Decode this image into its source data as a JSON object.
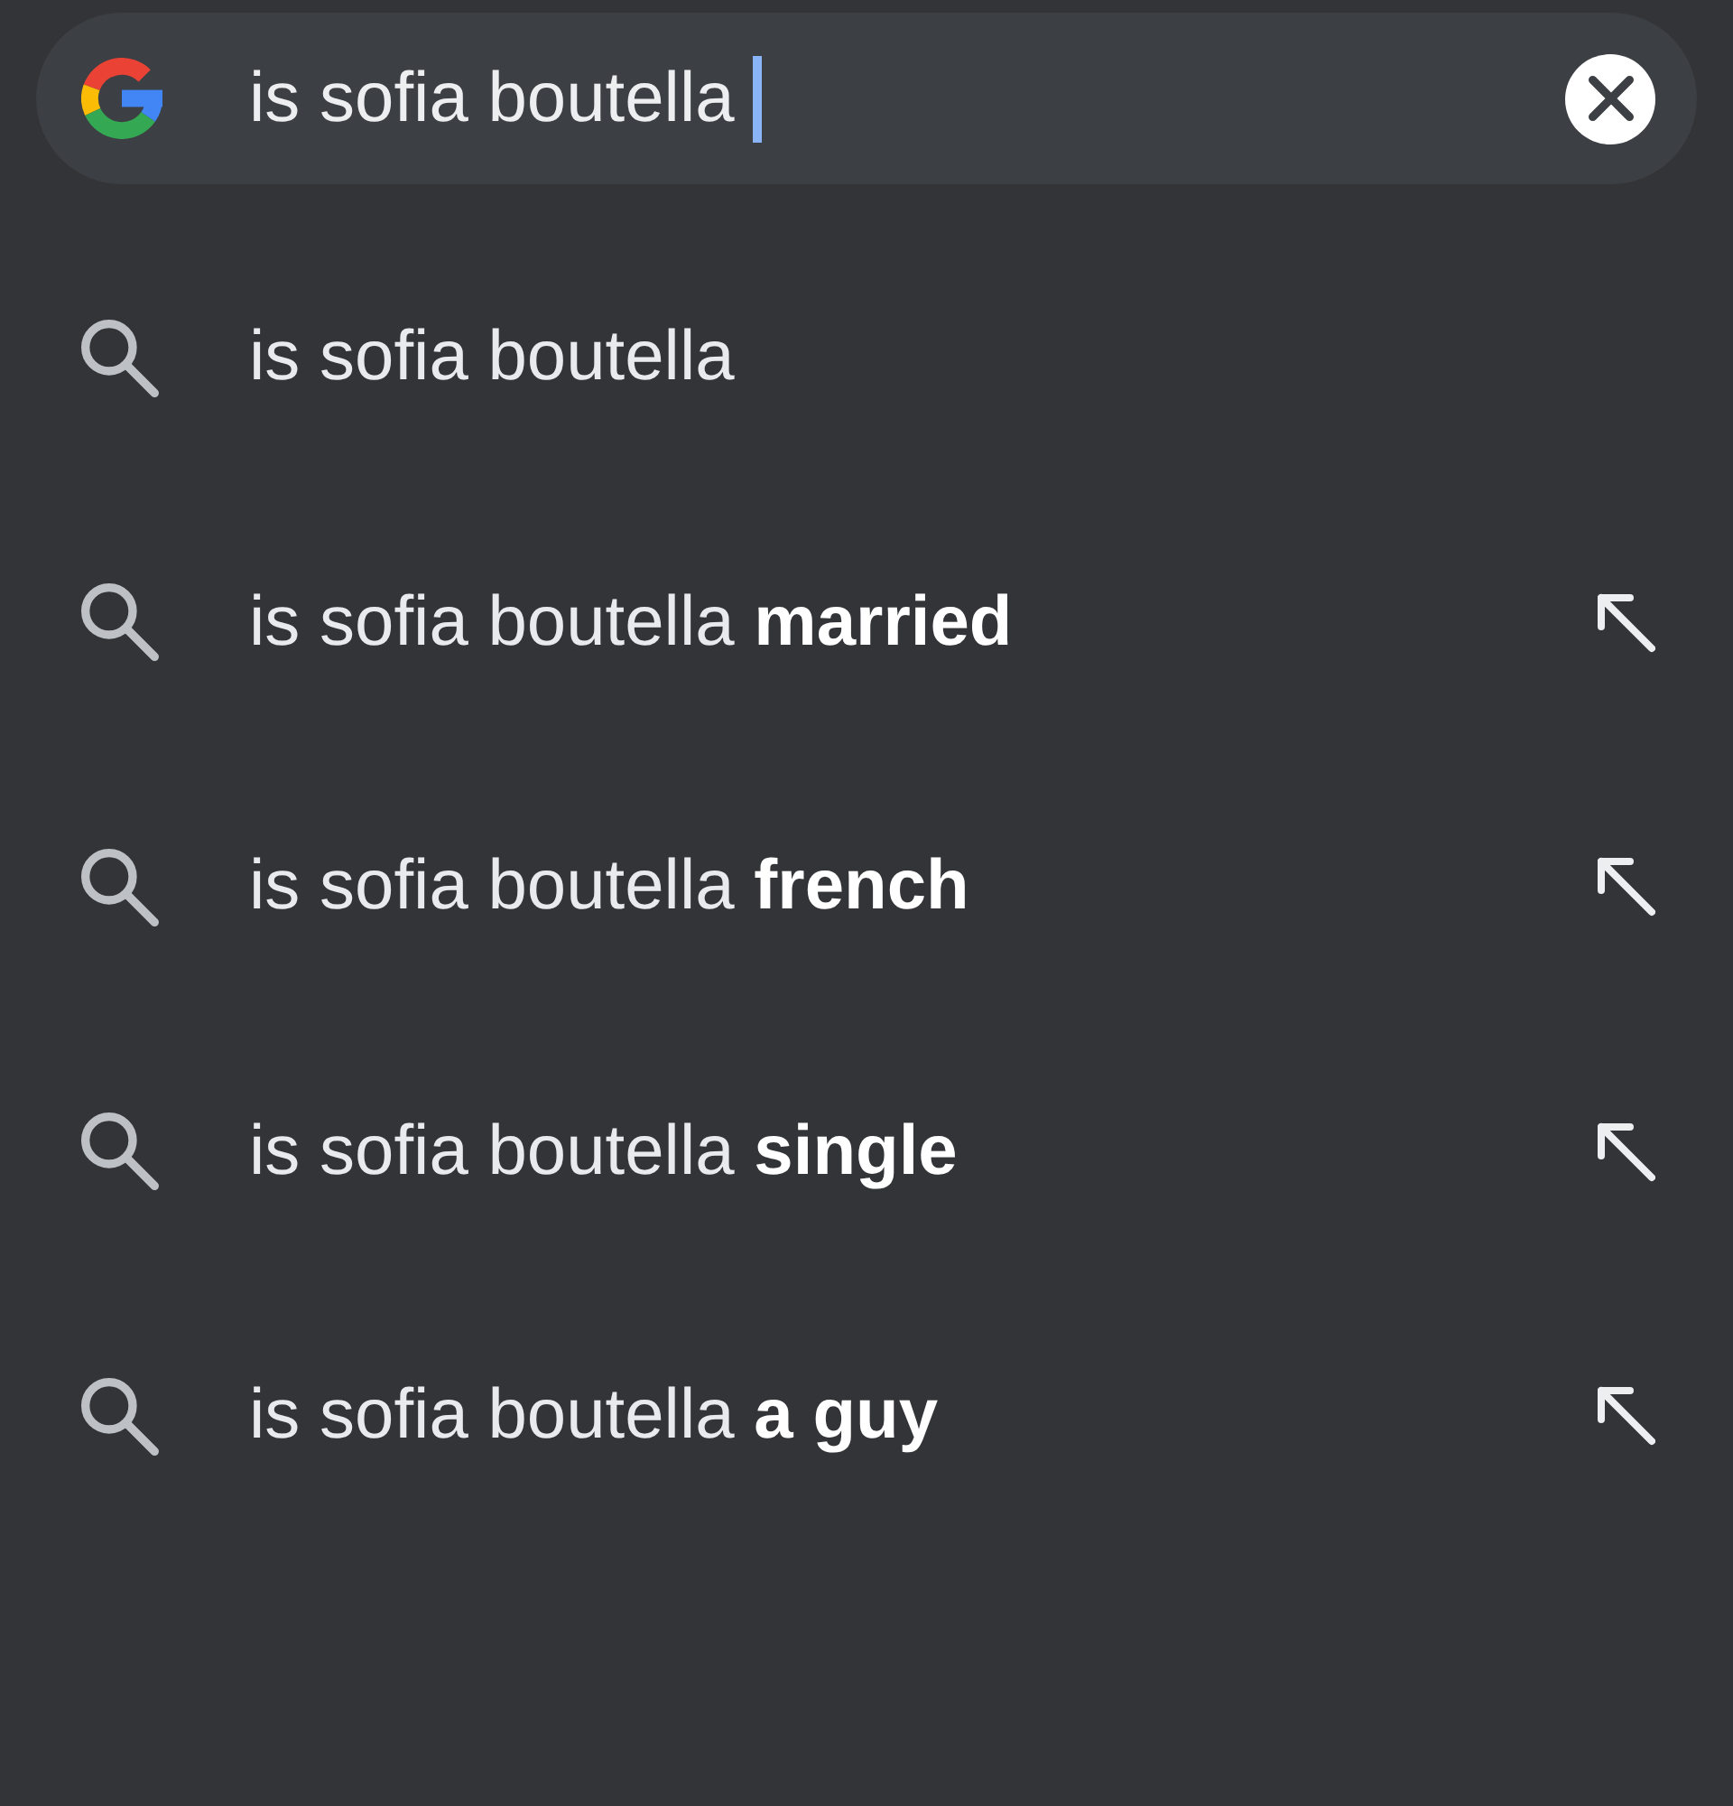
{
  "search_bar": {
    "value": "is sofia boutella"
  },
  "suggestions": [
    {
      "kind": "query",
      "text": "is sofia boutella"
    },
    {
      "kind": "completion",
      "text": "is sofia boutella **married**"
    },
    {
      "kind": "completion",
      "text": "is sofia boutella **french**"
    },
    {
      "kind": "completion",
      "text": "is sofia boutella **single**"
    },
    {
      "kind": "completion",
      "text": "is sofia boutella **a guy**"
    }
  ]
}
